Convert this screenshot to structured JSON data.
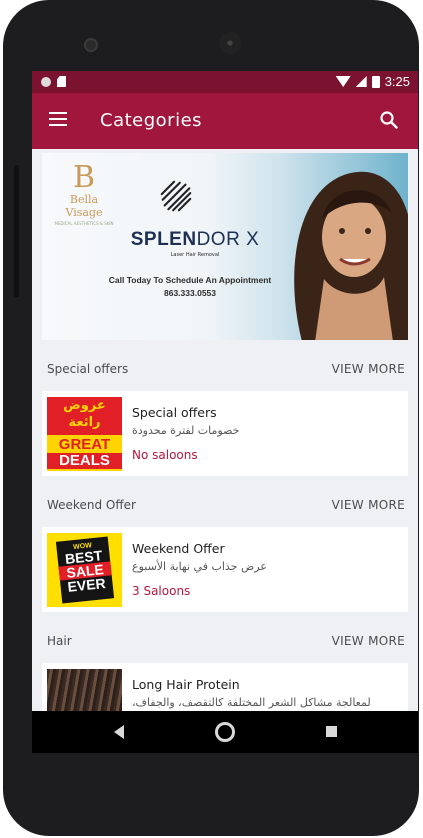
{
  "status_bar": {
    "time": "3:25"
  },
  "app_bar": {
    "title": "Categories"
  },
  "banner": {
    "logo_name": "Bella Visage",
    "logo_sub": "MEDICAL AESTHETICS & SKIN",
    "brand_bold": "SPLEN",
    "brand_rest": "DOR X",
    "brand_sub": "Laser Hair Removal",
    "call_line": "Call Today To Schedule An Appointment",
    "phone": "863.333.0553"
  },
  "sections": [
    {
      "title": "Special offers",
      "more": "VIEW MORE",
      "card": {
        "title": "Special offers",
        "desc": "خصومات لفترة محدودة",
        "count": "No saloons",
        "thumb_top": "عروض",
        "thumb_mid": "رائعة",
        "thumb_b1": "GREAT",
        "thumb_b2": "DEALS"
      }
    },
    {
      "title": "Weekend Offer",
      "more": "VIEW MORE",
      "card": {
        "title": "Weekend Offer",
        "desc": "عرض جذاب في نهاية الأسبوع",
        "count": "3 Saloons",
        "thumb_w1": "WOW",
        "thumb_w2": "BEST",
        "thumb_w3": "SALE",
        "thumb_w4": "EVER"
      }
    },
    {
      "title": "Hair",
      "more": "VIEW MORE",
      "card": {
        "title": "Long Hair Protein",
        "desc": "لمعالجة مشاكل الشعر المختلفة كالتقصف، والجفاف،",
        "count": ""
      }
    }
  ],
  "colors": {
    "primary": "#a0163c",
    "status": "#7b1330",
    "accent": "#b2173c"
  },
  "icons": [
    "menu-icon",
    "search-icon",
    "back-icon",
    "home-icon",
    "recents-icon"
  ]
}
